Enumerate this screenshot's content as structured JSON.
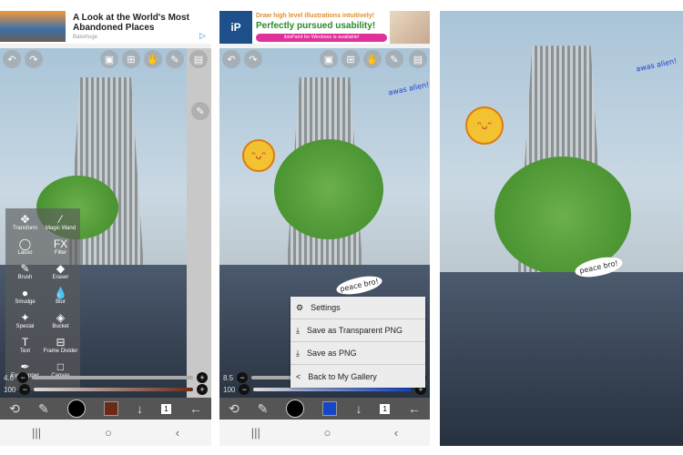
{
  "panel1": {
    "ad": {
      "title": "A Look at the World's Most Abandoned Places",
      "source": "Bakehuge"
    },
    "tools": [
      {
        "label": "Transform",
        "icon": "move-icon"
      },
      {
        "label": "Magic Wand",
        "icon": "magic-wand-icon"
      },
      {
        "label": "Lasso",
        "icon": "lasso-icon"
      },
      {
        "label": "Filter",
        "icon": "fx-icon"
      },
      {
        "label": "Brush",
        "icon": "brush-icon"
      },
      {
        "label": "Eraser",
        "icon": "eraser-icon"
      },
      {
        "label": "Smudge",
        "icon": "smudge-icon"
      },
      {
        "label": "Blur",
        "icon": "blur-icon"
      },
      {
        "label": "Special",
        "icon": "special-icon"
      },
      {
        "label": "Bucket",
        "icon": "bucket-icon"
      },
      {
        "label": "Text",
        "icon": "text-icon"
      },
      {
        "label": "Frame Divider",
        "icon": "frame-divider-icon"
      },
      {
        "label": "Eyedropper",
        "icon": "eyedropper-icon"
      },
      {
        "label": "Canvas",
        "icon": "canvas-icon"
      }
    ],
    "brush_size": "4.6",
    "opacity": "100",
    "color": "#6b2a16",
    "layer_count": "1",
    "fx": "FX"
  },
  "panel2": {
    "ad": {
      "line1": "Draw high level illustrations intuitively!",
      "line2": "Perfectly pursued usability!",
      "line3": "ibisPaint for Windows is available!",
      "logo": "iP"
    },
    "menu": [
      {
        "label": "Settings",
        "icon": "gear-icon"
      },
      {
        "label": "Save as Transparent PNG",
        "icon": "download-icon"
      },
      {
        "label": "Save as PNG",
        "icon": "download-icon"
      },
      {
        "label": "Back to My Gallery",
        "icon": "chevron-left-icon"
      }
    ],
    "brush_size": "8.5",
    "opacity": "100",
    "color": "#1446c8",
    "layer_count": "1"
  },
  "drawing": {
    "alien_text": "awas alien!",
    "peace_text": "peace bro!"
  }
}
